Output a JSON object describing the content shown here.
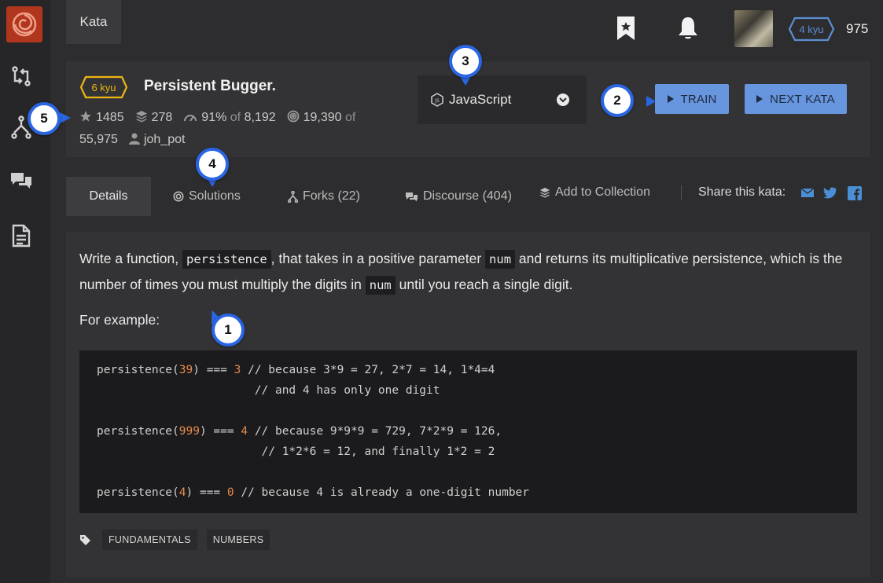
{
  "nav": {
    "kata_tab": "Kata",
    "honor": "975",
    "rank_badge": "4 kyu"
  },
  "kata": {
    "rank": "6 kyu",
    "title": "Persistent Bugger.",
    "stars": "1485",
    "collections": "278",
    "satisfaction_pct": "91%",
    "satisfaction_of": "of",
    "satisfaction_total": "8,192",
    "completions": "19,390",
    "completions_of": "of",
    "completions_total": "55,975",
    "author": "joh_pot"
  },
  "language": {
    "selected": "JavaScript"
  },
  "buttons": {
    "train": "TRAIN",
    "next_kata": "NEXT KATA"
  },
  "tabs": {
    "details": "Details",
    "solutions": "Solutions",
    "forks": "Forks (22)",
    "discourse": "Discourse (404)",
    "add_collection": "Add to Collection",
    "share": "Share this kata:"
  },
  "description": {
    "p1_a": "Write a function, ",
    "p1_code1": "persistence",
    "p1_b": ", that takes in a positive parameter ",
    "p1_code2": "num",
    "p1_c": " and returns its multiplicative persistence, which is the number of times you must multiply the digits in ",
    "p1_code3": "num",
    "p1_d": " until you reach a single digit.",
    "for_example": "For example:"
  },
  "code": {
    "l1_a": "persistence(",
    "l1_n": "39",
    "l1_b": ") === ",
    "l1_r": "3",
    "l1_c": " // because 3*9 = 27, 2*7 = 14, 1*4=4",
    "l2": "                       // and 4 has only one digit",
    "l4_a": "persistence(",
    "l4_n": "999",
    "l4_b": ") === ",
    "l4_r": "4",
    "l4_c": " // because 9*9*9 = 729, 7*2*9 = 126,",
    "l5": "                        // 1*2*6 = 12, and finally 1*2 = 2",
    "l7_a": "persistence(",
    "l7_n": "4",
    "l7_b": ") === ",
    "l7_r": "0",
    "l7_c": " // because 4 is already a one-digit number"
  },
  "tags": [
    "FUNDAMENTALS",
    "NUMBERS"
  ],
  "markers": [
    "1",
    "2",
    "3",
    "4",
    "5"
  ],
  "colors": {
    "accent_blue": "#6795de",
    "kyu_yellow": "#ecb613",
    "marker_ring": "#2a66e3"
  }
}
